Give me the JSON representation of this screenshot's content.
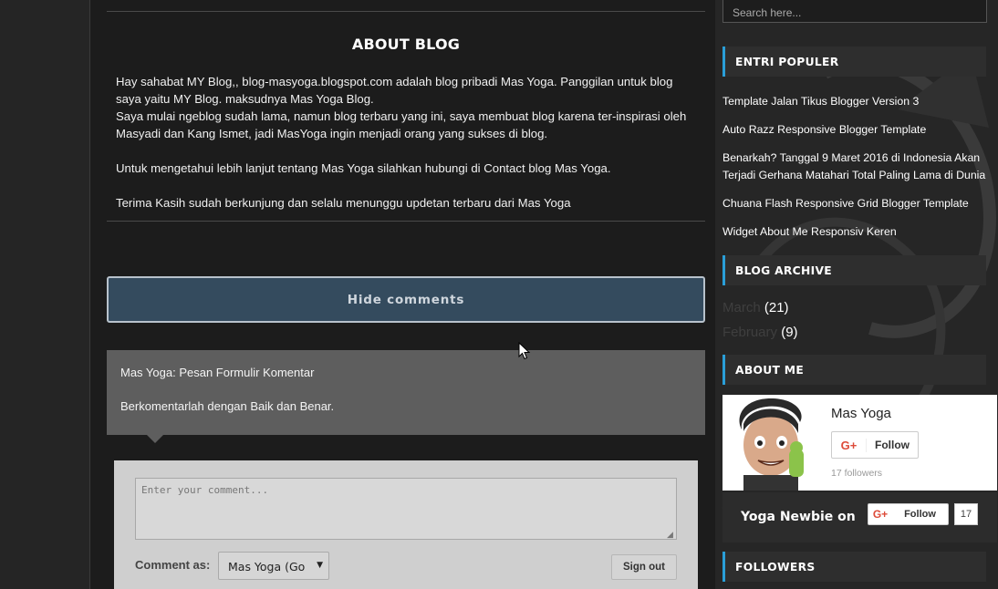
{
  "main": {
    "about_title": "ABOUT BLOG",
    "about_paragraphs": [
      "Hay sahabat MY Blog,, blog-masyoga.blogspot.com adalah blog pribadi Mas Yoga. Panggilan untuk blog saya yaitu MY Blog. maksudnya Mas Yoga Blog.",
      "Saya mulai ngeblog sudah lama, namun blog terbaru yang ini, saya membuat blog karena ter-inspirasi oleh Masyadi dan Kang Ismet, jadi MasYoga ingin menjadi orang yang sukses di blog.",
      "Untuk mengetahui lebih lanjut tentang Mas Yoga silahkan hubungi di Contact blog Mas Yoga.",
      "Terima Kasih sudah berkunjung dan selalu menunggu updetan terbaru dari Mas Yoga"
    ],
    "hide_comments_label": "Hide comments",
    "comment_message_line1": "Mas Yoga: Pesan Formulir Komentar",
    "comment_message_line2": "Berkomentarlah dengan Baik dan Benar.",
    "comment_placeholder": "Enter your comment...",
    "comment_as_label": "Comment as:",
    "identity_value": "Mas Yoga (Go",
    "sign_out_label": "Sign out"
  },
  "sidebar": {
    "search_placeholder": "Search here...",
    "popular_heading": "ENTRI POPULER",
    "popular_posts": [
      "Template Jalan Tikus Blogger Version 3",
      "Auto Razz Responsive Blogger Template",
      "Benarkah? Tanggal 9 Maret 2016 di Indonesia Akan Terjadi Gerhana Matahari Total Paling Lama di Dunia",
      "Chuana Flash Responsive Grid Blogger Template",
      "Widget About Me Responsiv Keren"
    ],
    "archive_heading": "BLOG ARCHIVE",
    "archive": [
      {
        "month": "March",
        "count": "(21)"
      },
      {
        "month": "February",
        "count": "(9)"
      }
    ],
    "about_me_heading": "ABOUT ME",
    "profile_name": "Mas Yoga",
    "profile_follow_label": "Follow",
    "profile_followers": "17 followers",
    "page_name": "Yoga Newbie on",
    "page_follow_label": "Follow",
    "page_follow_count": "17",
    "followers_heading": "FOLLOWERS"
  },
  "colors": {
    "accent": "#2a9fd8",
    "button_bg": "#344b5e",
    "gplus_red": "#dd4b39"
  }
}
